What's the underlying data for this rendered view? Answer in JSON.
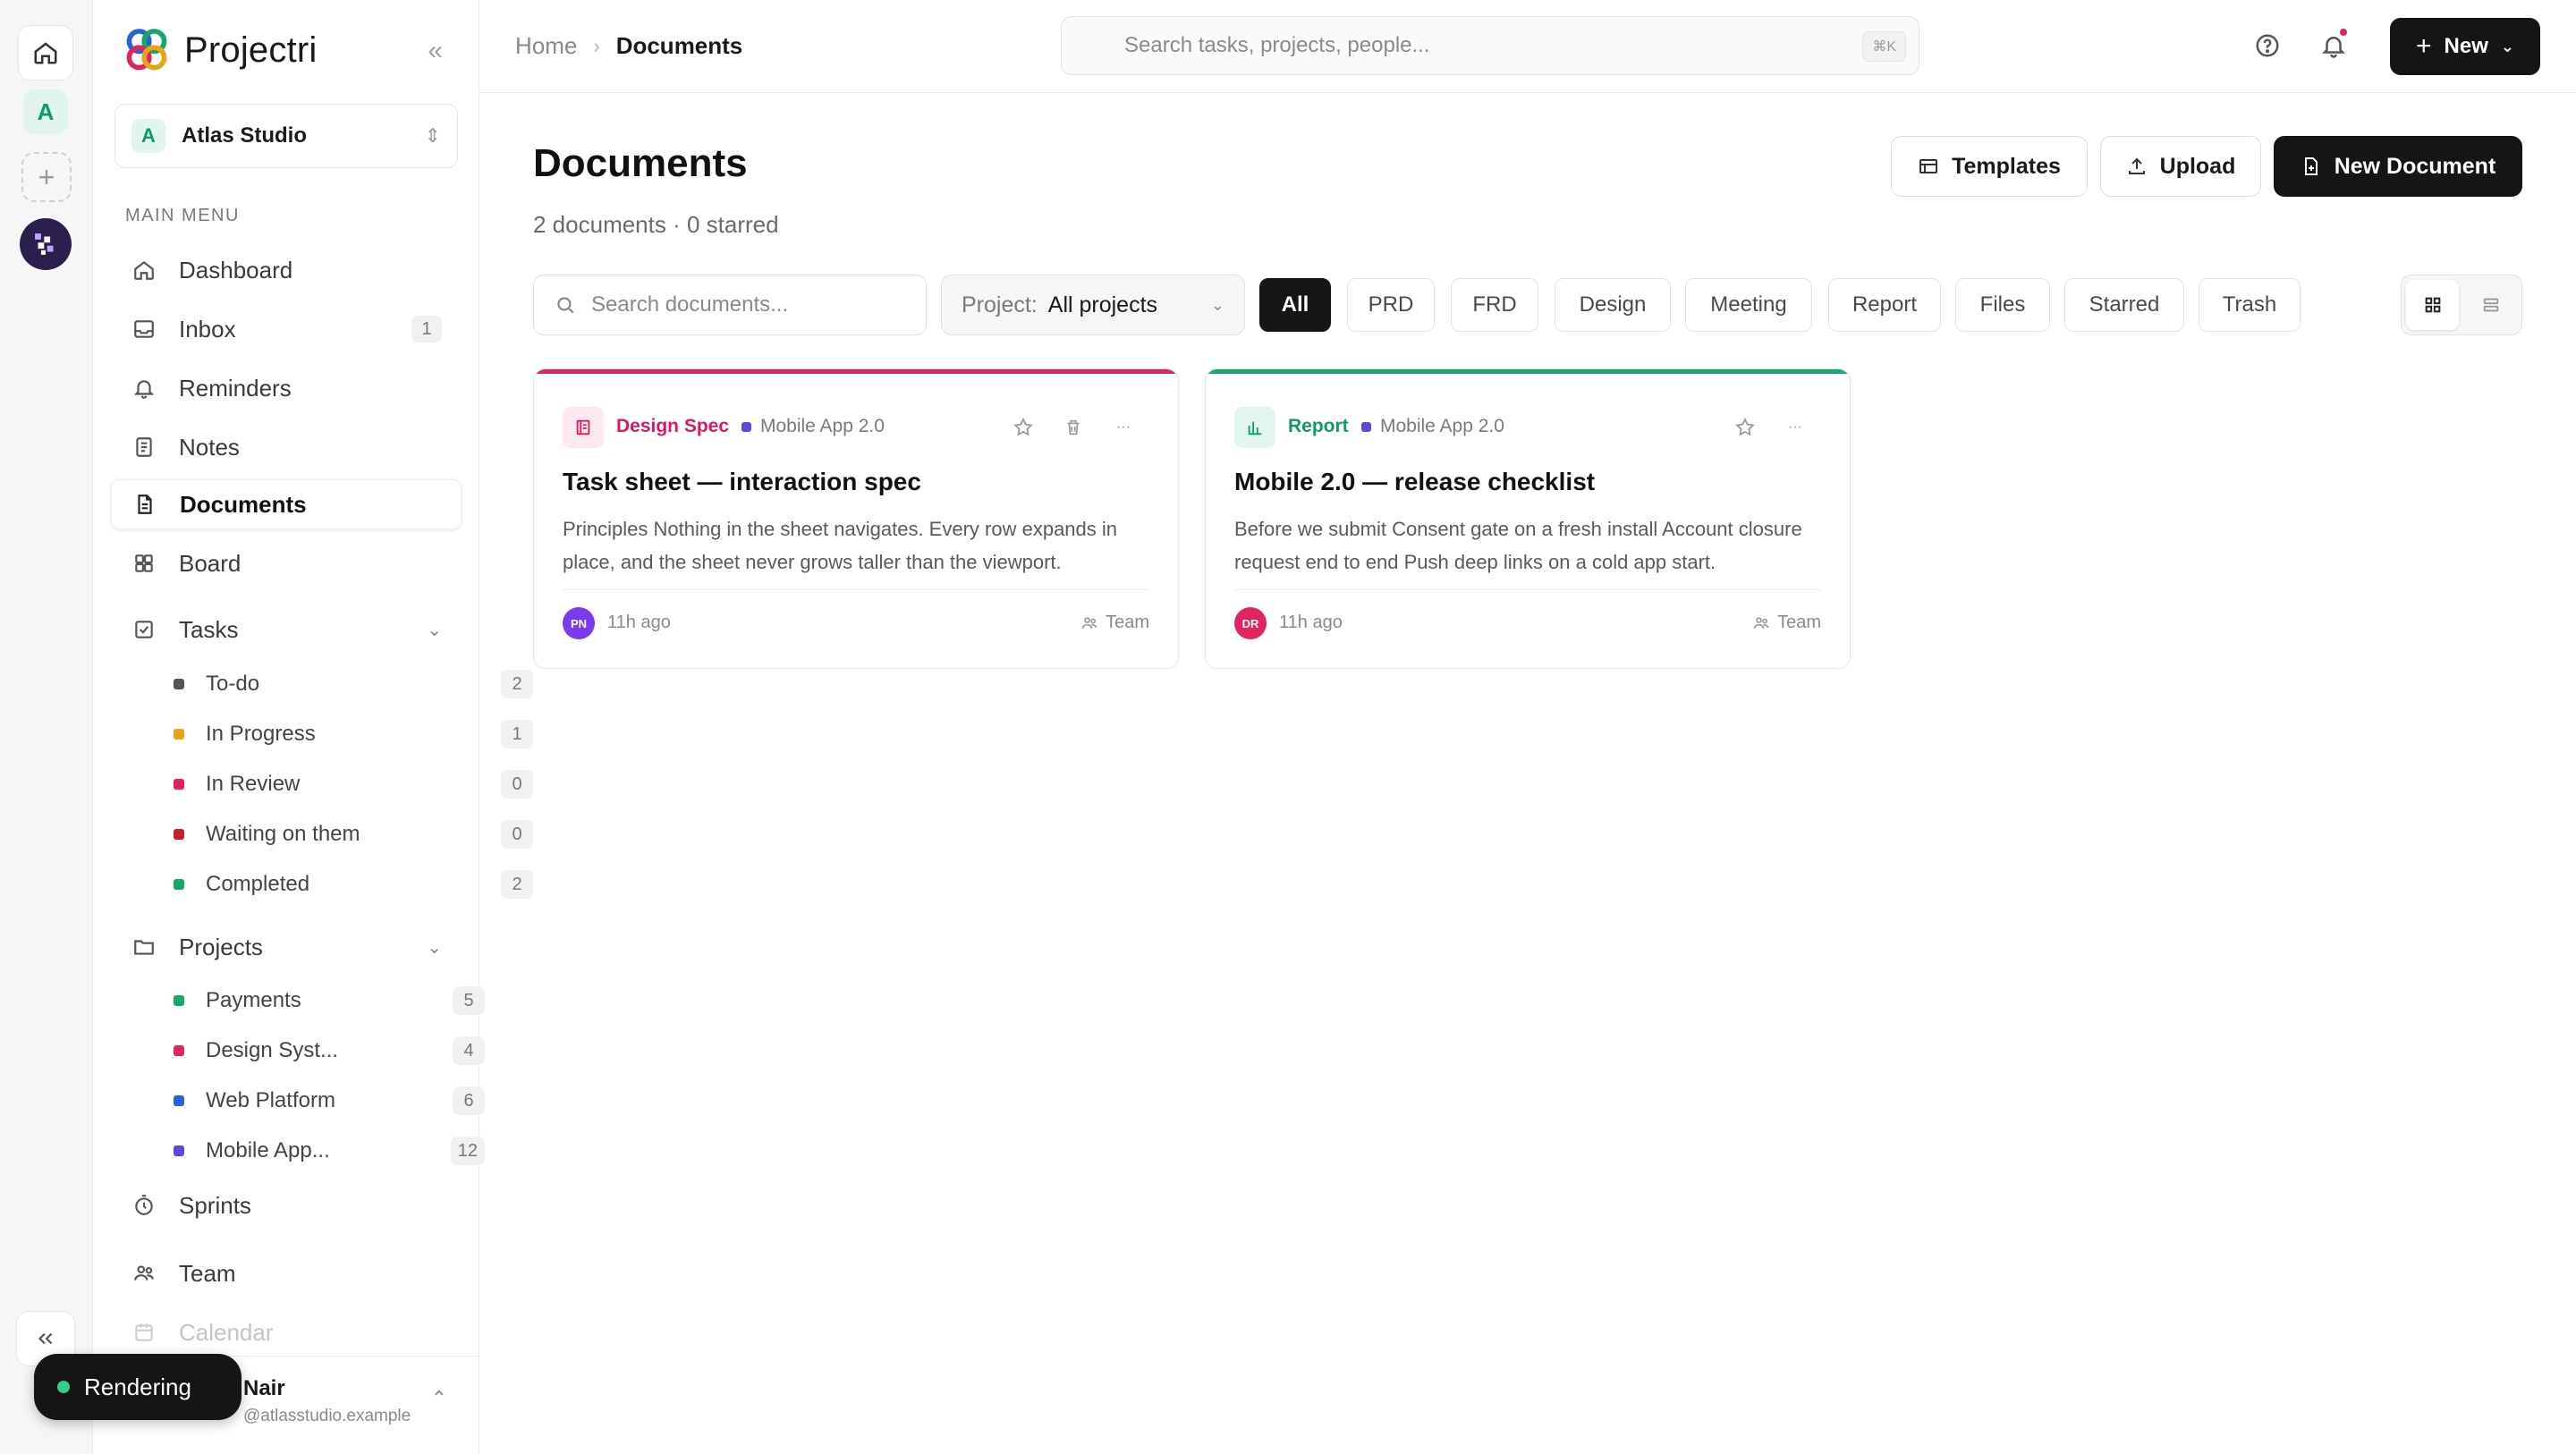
{
  "app": {
    "name": "Projectri"
  },
  "rail": {
    "workspace_initial": "A"
  },
  "workspace": {
    "initial": "A",
    "name": "Atlas Studio"
  },
  "sidebar": {
    "menu_label": "MAIN MENU",
    "items": [
      {
        "label": "Dashboard",
        "icon": "home-icon"
      },
      {
        "label": "Inbox",
        "icon": "inbox-icon",
        "badge": "1"
      },
      {
        "label": "Reminders",
        "icon": "bell-icon"
      },
      {
        "label": "Notes",
        "icon": "note-icon"
      },
      {
        "label": "Documents",
        "icon": "document-icon",
        "active": true
      },
      {
        "label": "Board",
        "icon": "board-icon"
      }
    ],
    "tasks": {
      "label": "Tasks",
      "items": [
        {
          "label": "To-do",
          "count": "2",
          "color": "#555555"
        },
        {
          "label": "In Progress",
          "count": "1",
          "color": "#e8a317"
        },
        {
          "label": "In Review",
          "count": "0",
          "color": "#e0245e"
        },
        {
          "label": "Waiting on them",
          "count": "0",
          "color": "#c41e2e"
        },
        {
          "label": "Completed",
          "count": "2",
          "color": "#14a86b"
        }
      ]
    },
    "projects": {
      "label": "Projects",
      "items": [
        {
          "label": "Payments",
          "count": "5",
          "color": "#14a86b"
        },
        {
          "label": "Design Syst...",
          "count": "4",
          "color": "#e0245e"
        },
        {
          "label": "Web Platform",
          "count": "6",
          "color": "#2563d9"
        },
        {
          "label": "Mobile App...",
          "count": "12",
          "color": "#5b4bd8"
        }
      ]
    },
    "bottom_items": [
      {
        "label": "Sprints",
        "icon": "timer-icon"
      },
      {
        "label": "Team",
        "icon": "team-icon"
      },
      {
        "label": "Calendar",
        "icon": "calendar-icon"
      }
    ],
    "user": {
      "name": "Nair",
      "email": "@atlasstudio.example"
    }
  },
  "toast": {
    "label": "Rendering"
  },
  "topbar": {
    "breadcrumb": {
      "home": "Home",
      "current": "Documents"
    },
    "search_placeholder": "Search tasks, projects, people...",
    "search_shortcut": "⌘K",
    "new_label": "New"
  },
  "page": {
    "title": "Documents",
    "subtitle": "2 documents · 0 starred",
    "buttons": {
      "templates": "Templates",
      "upload": "Upload",
      "new_document": "New Document"
    },
    "filters": {
      "search_placeholder": "Search documents...",
      "project_label": "Project:",
      "project_value": "All projects",
      "chips": [
        "All",
        "PRD",
        "FRD",
        "Design",
        "Meeting",
        "Report",
        "Files",
        "Starred",
        "Trash"
      ],
      "active_chip": "All",
      "view": "grid"
    }
  },
  "documents": [
    {
      "type": "Design Spec",
      "type_color": "#d81b60",
      "accent": "#e0245e",
      "project": "Mobile App 2.0",
      "title": "Task sheet — interaction spec",
      "description": "Principles Nothing in the sheet navigates. Every row expands in place, and the sheet never grows taller than the viewport.",
      "author_initials": "PN",
      "avatar_color": "#7c3aed",
      "time": "11h ago",
      "visibility": "Team"
    },
    {
      "type": "Report",
      "type_color": "#0f9a6d",
      "accent": "#14a86b",
      "project": "Mobile App 2.0",
      "title": "Mobile 2.0 — release checklist",
      "description": "Before we submit Consent gate on a fresh install Account closure request end to end Push deep links on a cold app start.",
      "author_initials": "DR",
      "avatar_color": "#e0245e",
      "time": "11h ago",
      "visibility": "Team"
    }
  ]
}
